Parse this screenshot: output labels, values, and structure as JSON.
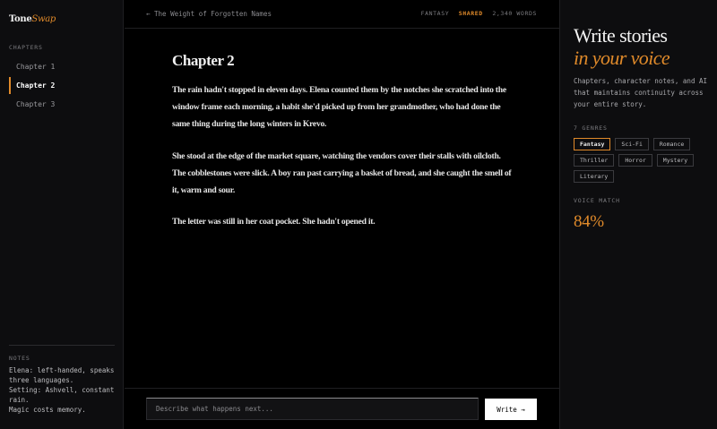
{
  "app": {
    "logo_main": "Tone",
    "logo_accent": "Swap",
    "accent_color": "#e08a2a"
  },
  "sidebar": {
    "chapters_label": "CHAPTERS",
    "chapters": [
      {
        "label": "Chapter 1",
        "active": false
      },
      {
        "label": "Chapter 2",
        "active": true
      },
      {
        "label": "Chapter 3",
        "active": false
      }
    ],
    "notes_label": "NOTES",
    "notes": "Elena: left-handed, speaks three languages.\nSetting: Ashvell, constant rain.\nMagic costs memory."
  },
  "topbar": {
    "back_link": "← The Weight of Forgotten Names",
    "genre": "FANTASY",
    "status": "SHARED",
    "word_count": "2,340 WORDS"
  },
  "document": {
    "chapter_title": "Chapter 2",
    "paragraphs": [
      "The rain hadn't stopped in eleven days. Elena counted them by the notches she scratched into the window frame each morning, a habit she'd picked up from her grandmother, who had done the same thing during the long winters in Krevo.",
      "She stood at the edge of the market square, watching the vendors cover their stalls with oilcloth. The cobblestones were slick. A boy ran past carrying a basket of bread, and she caught the smell of it, warm and sour.",
      "The letter was still in her coat pocket. She hadn't opened it."
    ]
  },
  "composer": {
    "placeholder": "Describe what happens next...",
    "button_label": "Write →"
  },
  "panel": {
    "hero_line1": "Write stories",
    "hero_line2": "in your voice",
    "description": "Chapters, character notes, and AI that maintains continuity across your entire story.",
    "genres_label": "7 GENRES",
    "genres": [
      {
        "label": "Fantasy",
        "active": true
      },
      {
        "label": "Sci-Fi",
        "active": false
      },
      {
        "label": "Romance",
        "active": false
      },
      {
        "label": "Thriller",
        "active": false
      },
      {
        "label": "Horror",
        "active": false
      },
      {
        "label": "Mystery",
        "active": false
      },
      {
        "label": "Literary",
        "active": false
      }
    ],
    "voice_match_label": "VOICE MATCH",
    "voice_match_value": "84%"
  }
}
